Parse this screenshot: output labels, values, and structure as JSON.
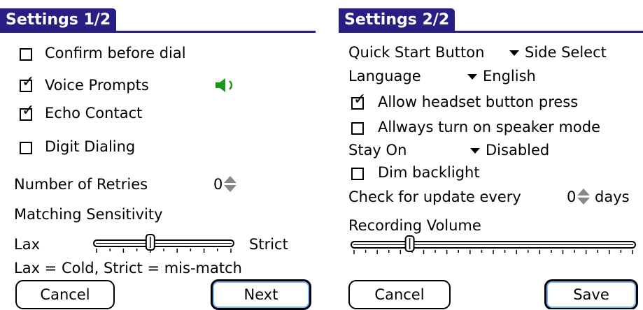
{
  "panel1": {
    "title": "Settings 1/2",
    "checkboxes": [
      {
        "label": "Confirm before dial",
        "checked": false
      },
      {
        "label": "Voice Prompts",
        "checked": true
      },
      {
        "label": "Echo Contact",
        "checked": true
      },
      {
        "label": "Digit Dialing",
        "checked": false
      }
    ],
    "voice_prompt_icon": "speaker-icon",
    "retries_label": "Number of Retries",
    "retries_value": "0",
    "sensitivity_label": "Matching Sensitivity",
    "lax_label": "Lax",
    "strict_label": "Strict",
    "sensitivity_level": 0.4,
    "legend": "Lax = Cold, Strict = mis-match",
    "cancel_label": "Cancel",
    "next_label": "Next"
  },
  "panel2": {
    "title": "Settings 2/2",
    "quick_start_label": "Quick Start Button",
    "quick_start_value": "Side Select",
    "language_label": "Language",
    "language_value": "English",
    "checkboxes": [
      {
        "label": "Allow headset button press",
        "checked": true
      },
      {
        "label": "Allways turn on speaker mode",
        "checked": false
      }
    ],
    "stay_on_label": "Stay On",
    "stay_on_value": "Disabled",
    "dim_backlight_label": "Dim backlight",
    "dim_backlight_checked": false,
    "update_label": "Check for update every",
    "update_value": "0",
    "update_unit": "days",
    "recording_volume_label": "Recording Volume",
    "recording_volume_level": 0.2,
    "cancel_label": "Cancel",
    "save_label": "Save"
  },
  "colors": {
    "titlebar": "#272082",
    "speaker": "#1a9a1a",
    "default_button_glow": "#7fb4ff"
  }
}
